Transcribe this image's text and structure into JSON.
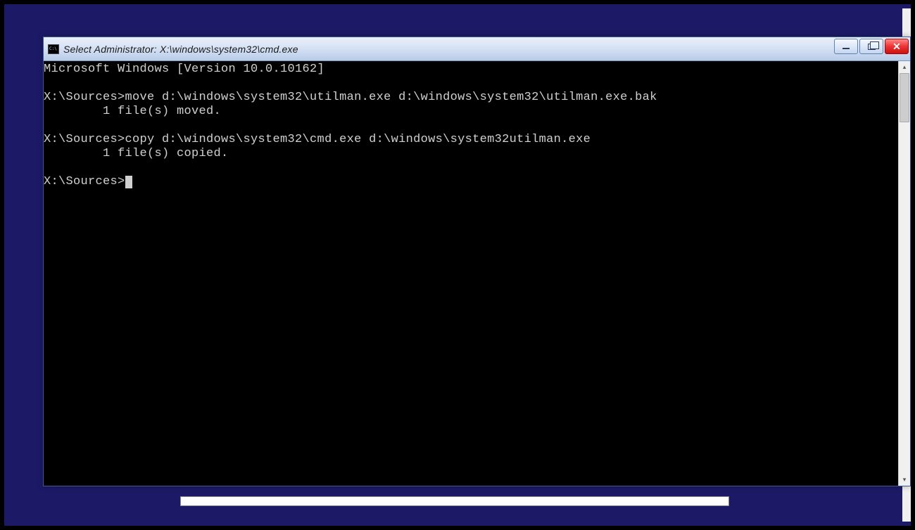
{
  "window": {
    "title": "Select Administrator: X:\\windows\\system32\\cmd.exe"
  },
  "terminal": {
    "lines": [
      "Microsoft Windows [Version 10.0.10162]",
      "",
      "X:\\Sources>move d:\\windows\\system32\\utilman.exe d:\\windows\\system32\\utilman.exe.bak",
      "        1 file(s) moved.",
      "",
      "X:\\Sources>copy d:\\windows\\system32\\cmd.exe d:\\windows\\system32utilman.exe",
      "        1 file(s) copied.",
      "",
      "X:\\Sources>"
    ]
  }
}
